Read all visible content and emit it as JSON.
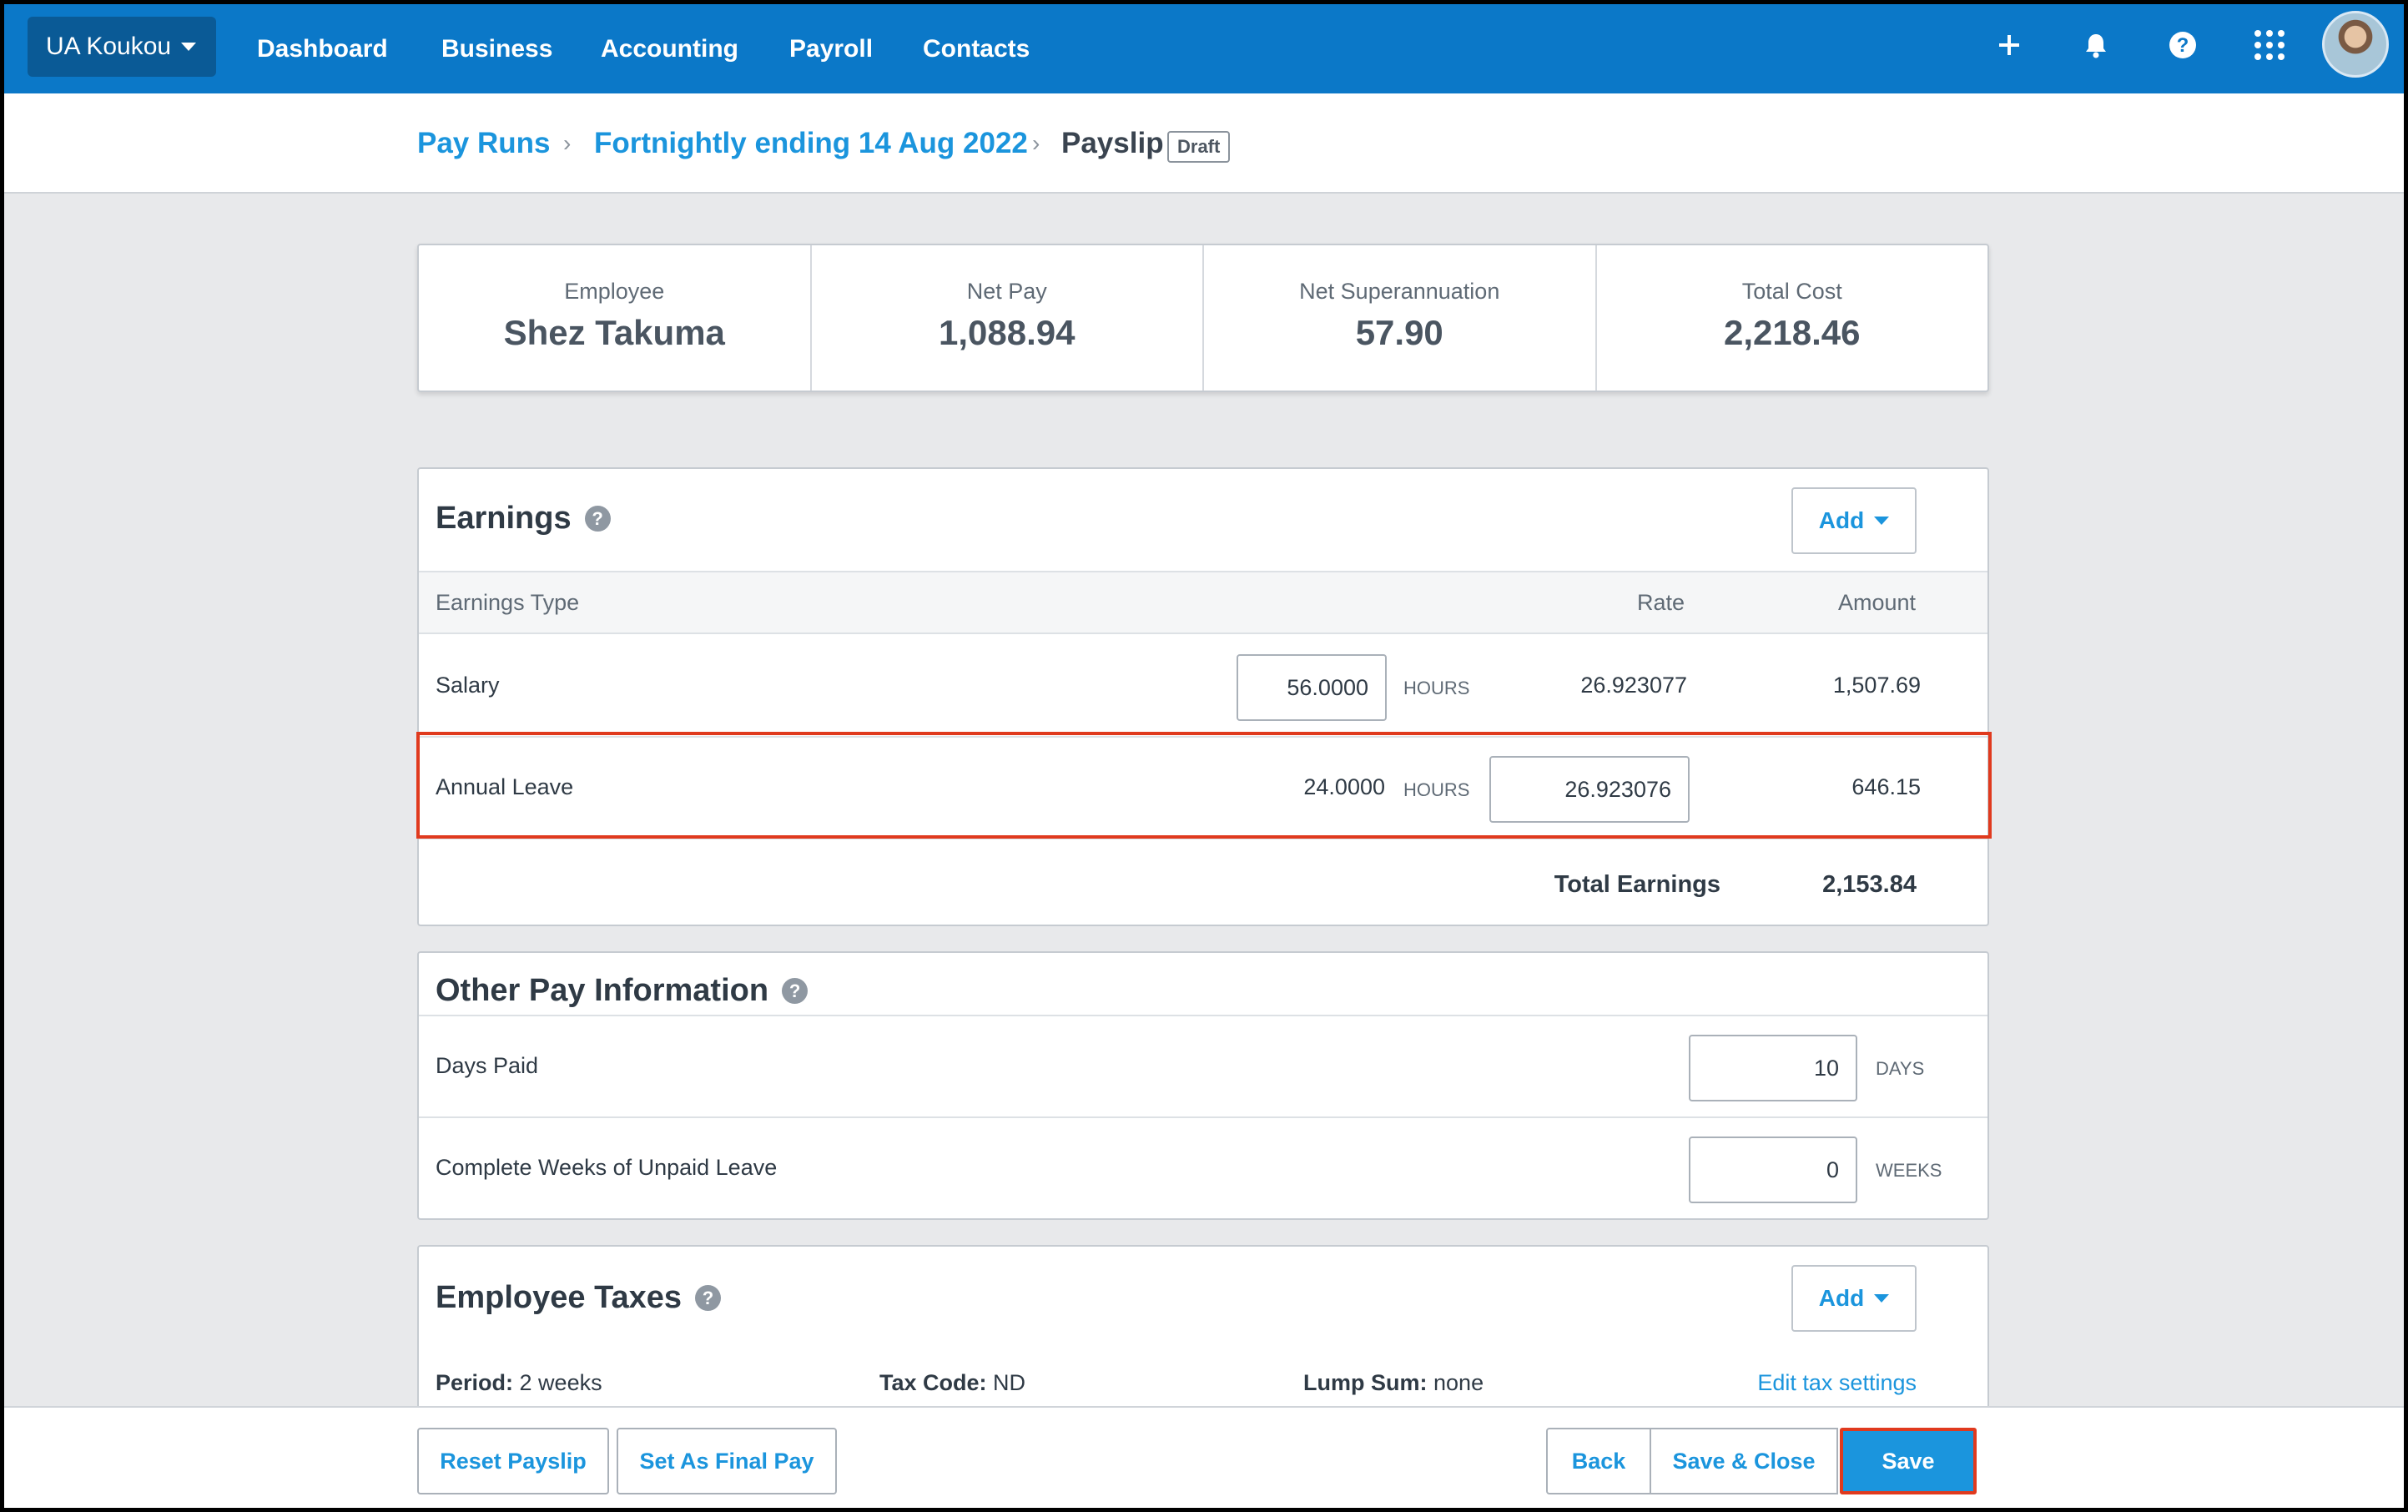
{
  "nav": {
    "org": "UA Koukou",
    "links": [
      "Dashboard",
      "Business",
      "Accounting",
      "Payroll",
      "Contacts"
    ],
    "icons": [
      "plus-icon",
      "bell-icon",
      "help-icon",
      "apps-grid-icon"
    ]
  },
  "breadcrumb": {
    "pay_runs": "Pay Runs",
    "period": "Fortnightly ending 14 Aug 2022",
    "current": "Payslip",
    "badge": "Draft"
  },
  "summary": {
    "employee_label": "Employee",
    "employee_value": "Shez Takuma",
    "net_pay_label": "Net Pay",
    "net_pay_value": "1,088.94",
    "net_super_label": "Net Superannuation",
    "net_super_value": "57.90",
    "total_cost_label": "Total Cost",
    "total_cost_value": "2,218.46"
  },
  "earnings": {
    "title": "Earnings",
    "add_label": "Add",
    "col_type": "Earnings Type",
    "col_rate": "Rate",
    "col_amount": "Amount",
    "rows": [
      {
        "type": "Salary",
        "qty": "56.0000",
        "unit": "HOURS",
        "rate": "26.923077",
        "amount": "1,507.69"
      },
      {
        "type": "Annual Leave",
        "qty": "24.0000",
        "unit": "HOURS",
        "rate": "26.923076",
        "amount": "646.15"
      }
    ],
    "total_label": "Total Earnings",
    "total_value": "2,153.84"
  },
  "other_pay": {
    "title": "Other Pay Information",
    "days_paid_label": "Days Paid",
    "days_paid_value": "10",
    "days_unit": "DAYS",
    "unpaid_label": "Complete Weeks of Unpaid Leave",
    "unpaid_value": "0",
    "weeks_unit": "WEEKS"
  },
  "taxes": {
    "title": "Employee Taxes",
    "add_label": "Add",
    "period_label": "Period:",
    "period_value": "2 weeks",
    "tax_code_label": "Tax Code:",
    "tax_code_value": "ND",
    "lump_sum_label": "Lump Sum:",
    "lump_sum_value": "none",
    "edit_link": "Edit tax settings"
  },
  "footer": {
    "reset": "Reset Payslip",
    "final": "Set As Final Pay",
    "back": "Back",
    "save_close": "Save & Close",
    "save": "Save"
  },
  "colors": {
    "nav_bg": "#0b78c8",
    "link": "#1b95dd",
    "highlight": "#e03a1e"
  }
}
